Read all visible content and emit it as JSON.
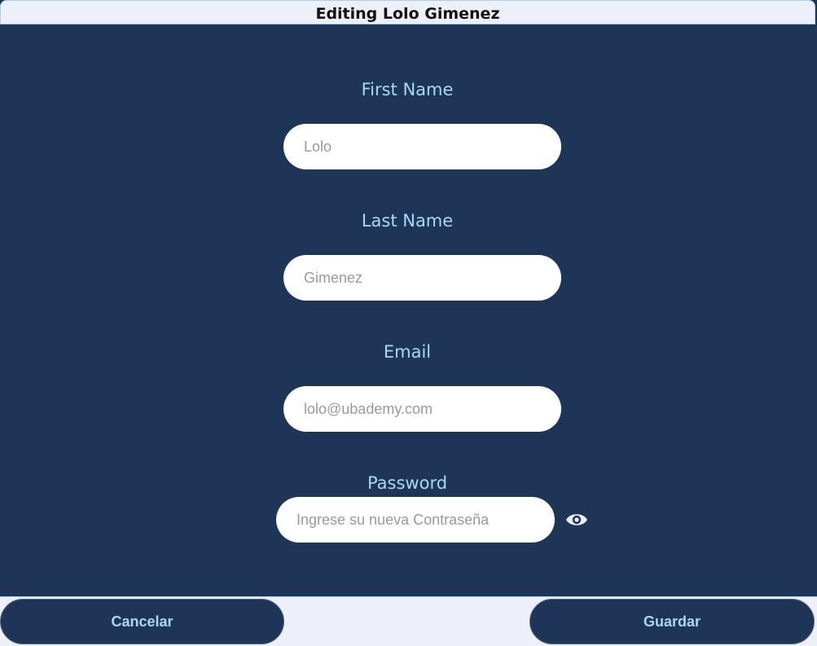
{
  "window": {
    "title": "Editing Lolo Gimenez"
  },
  "form": {
    "first_name": {
      "label": "First Name",
      "placeholder": "Lolo"
    },
    "last_name": {
      "label": "Last Name",
      "placeholder": "Gimenez"
    },
    "email": {
      "label": "Email",
      "placeholder": "lolo@ubademy.com"
    },
    "password": {
      "label": "Password",
      "placeholder": "Ingrese su nueva Contraseña",
      "toggle_icon": "eye-icon"
    }
  },
  "footer": {
    "cancel_label": "Cancelar",
    "save_label": "Guardar"
  },
  "colors": {
    "background": "#1e3557",
    "label": "#a9d7f7",
    "bar": "#edf0f8",
    "input": "#ffffff"
  }
}
